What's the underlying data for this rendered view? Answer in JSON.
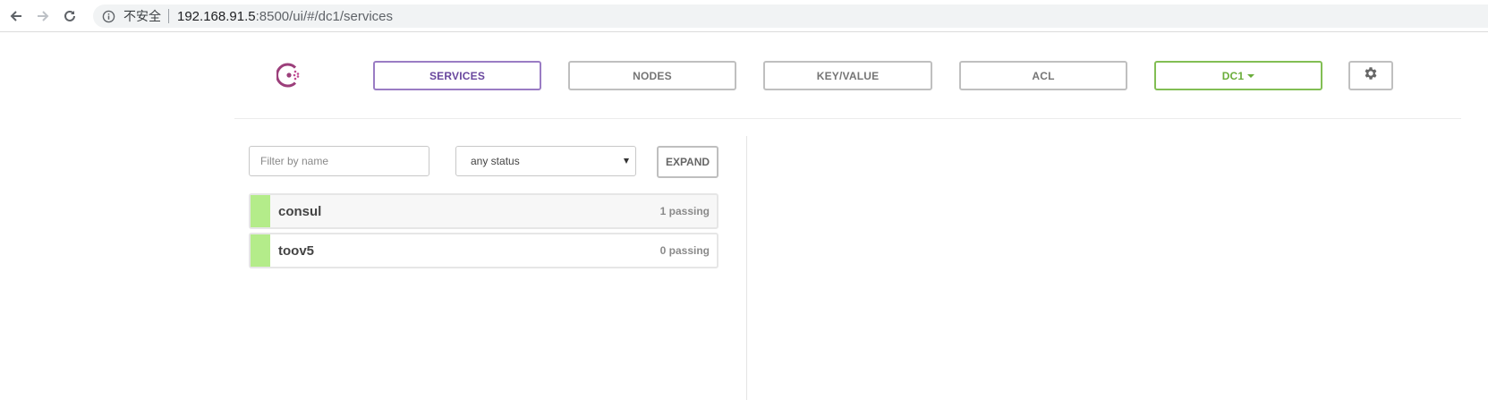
{
  "browser": {
    "security_label": "不安全",
    "url_host": "192.168.91.5",
    "url_rest": ":8500/ui/#/dc1/services"
  },
  "header": {
    "logo_icon": "consul-logo-icon",
    "tabs": [
      {
        "label": "SERVICES",
        "active": true
      },
      {
        "label": "NODES",
        "active": false
      },
      {
        "label": "KEY/VALUE",
        "active": false
      },
      {
        "label": "ACL",
        "active": false
      }
    ],
    "datacenter": "DC1",
    "settings_icon": "gear-icon"
  },
  "filters": {
    "name_placeholder": "Filter by name",
    "status_selected": "any status",
    "expand_label": "EXPAND"
  },
  "services": [
    {
      "name": "consul",
      "status": "1 passing",
      "color": "#b4ec8a"
    },
    {
      "name": "toov5",
      "status": "0 passing",
      "color": "#b4ec8a"
    }
  ],
  "colors": {
    "accent_purple": "#69479e",
    "accent_green": "#6aad3a",
    "passing_green": "#b4ec8a"
  }
}
